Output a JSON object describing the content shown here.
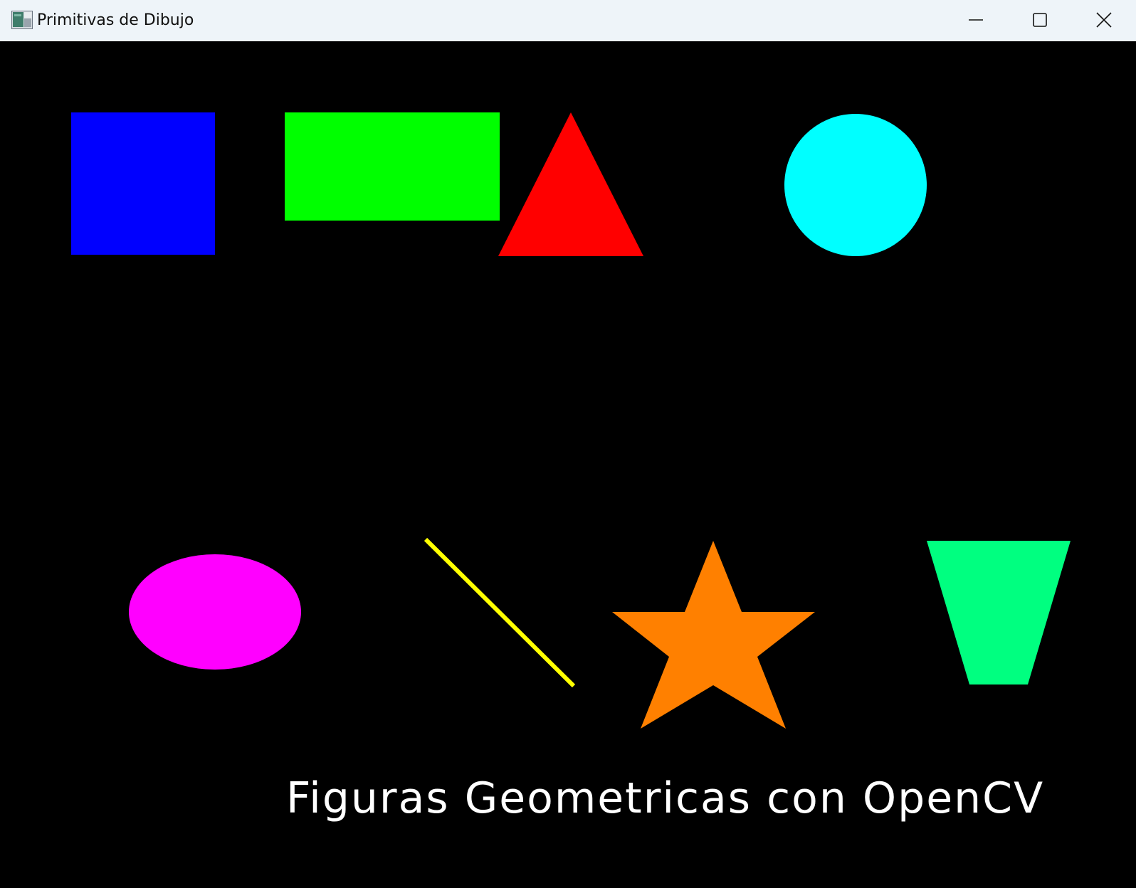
{
  "window": {
    "title": "Primitivas de Dibujo",
    "icon": "app-window-icon",
    "controls": {
      "minimize_icon": "minimize-icon",
      "maximize_icon": "maximize-icon",
      "close_icon": "close-icon"
    }
  },
  "canvas": {
    "background_color": "#000000",
    "caption": "Figuras Geometricas con OpenCV",
    "caption_color": "#ffffff",
    "shapes": [
      {
        "kind": "square",
        "color": "#0000ff"
      },
      {
        "kind": "rectangle",
        "color": "#00ff00"
      },
      {
        "kind": "triangle",
        "color": "#ff0000"
      },
      {
        "kind": "circle",
        "color": "#00ffff"
      },
      {
        "kind": "ellipse",
        "color": "#ff00ff"
      },
      {
        "kind": "line",
        "color": "#ffff00"
      },
      {
        "kind": "star",
        "color": "#ff8000"
      },
      {
        "kind": "trapezoid",
        "color": "#00ff80"
      }
    ]
  }
}
